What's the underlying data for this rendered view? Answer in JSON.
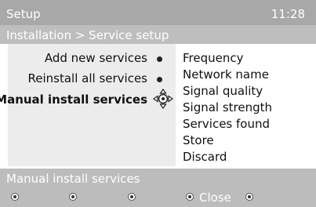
{
  "header": {
    "title": "Setup",
    "clock": "11:28",
    "breadcrumb": "Installation > Service setup"
  },
  "menu": {
    "items": [
      {
        "label": "Add new services"
      },
      {
        "label": "Reinstall all services"
      },
      {
        "label": "Manual install services"
      }
    ]
  },
  "submenu": {
    "items": [
      {
        "label": "Frequency"
      },
      {
        "label": "Network name"
      },
      {
        "label": "Signal quality"
      },
      {
        "label": "Signal strength"
      },
      {
        "label": "Services found"
      },
      {
        "label": "Store"
      },
      {
        "label": "Discard"
      }
    ]
  },
  "footer": {
    "label": "Manual install services",
    "close_label": "Close",
    "color_keys": [
      "red-key-icon",
      "green-key-icon",
      "yellow-key-icon",
      "blue-key-icon",
      "white-key-icon"
    ]
  }
}
